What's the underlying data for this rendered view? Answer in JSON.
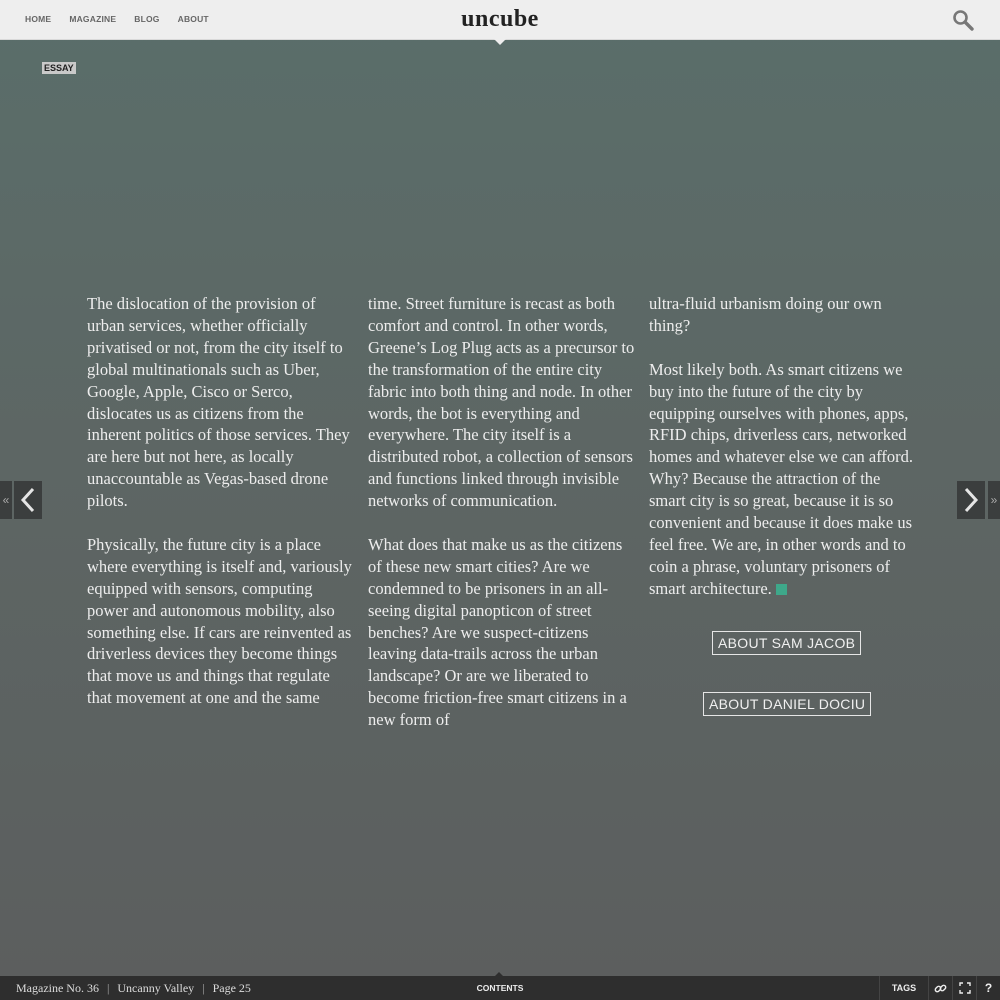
{
  "nav": {
    "home": "HOME",
    "magazine": "MAGAZINE",
    "blog": "BLOG",
    "about": "ABOUT"
  },
  "logo": "uncube",
  "tag": "ESSAY",
  "article": {
    "col1_p1": "The dislocation of the provision of urban services, whether officially privatised or not, from the city itself to global multinationals such as Uber, Google, Apple, Cisco or Serco, dislocates us as citizens from the inherent politics of those services. They are here but not here, as locally unaccountable as Vegas-based drone pilots.",
    "col1_p2": "Physically, the future city is a place where everything is itself and, variously equipped with sensors, computing power and autonomous mobility, also something else. If cars are reinvented as driverless devices they become things that move us and things that regulate that movement at one and the same",
    "col2_p1": "time. Street furniture is recast as both comfort and control. In other words, Greene’s Log Plug acts as a precursor to the transformation of the entire city fabric into both thing and node. In other words, the bot is everything and everywhere. The city itself is a distributed robot, a collection of sensors and functions linked through invisible networks of communication.",
    "col2_p2": "What does that make us as the citizens of these new smart cities? Are we condemned to be prisoners in an all-seeing digital panopticon of street benches? Are we suspect-citizens leaving data-trails across the urban landscape? Or are we liberated to become friction-free smart citizens in a new form of",
    "col3_p1": "ultra-fluid urbanism doing our own thing?",
    "col3_p2": "Most likely both. As smart citizens we buy into the future of the city by equipping ourselves with phones, apps, RFID chips, driverless cars, networked homes and whatever else we can afford. Why? Because the attraction of the smart city is so great, because it is so convenient and because it does make us feel free. We are, in other words and to coin a phrase, voluntary prisoners of smart architecture."
  },
  "buttons": {
    "about_sam": "ABOUT SAM JACOB",
    "about_daniel": "ABOUT DANIEL DOCIU"
  },
  "side_nav": {
    "first": "«",
    "last": "»"
  },
  "footer": {
    "magazine": "Magazine No. 36",
    "issue": "Uncanny Valley",
    "page": "Page 25",
    "separator": "|",
    "contents": "CONTENTS",
    "tags": "TAGS",
    "help": "?"
  },
  "colors": {
    "accent": "#3ea88a",
    "topbar": "#eeeeee",
    "bottombar": "#2e2e2e"
  },
  "icons": [
    "search-icon",
    "chevron-left-icon",
    "chevron-right-icon",
    "link-icon",
    "fullscreen-icon"
  ]
}
